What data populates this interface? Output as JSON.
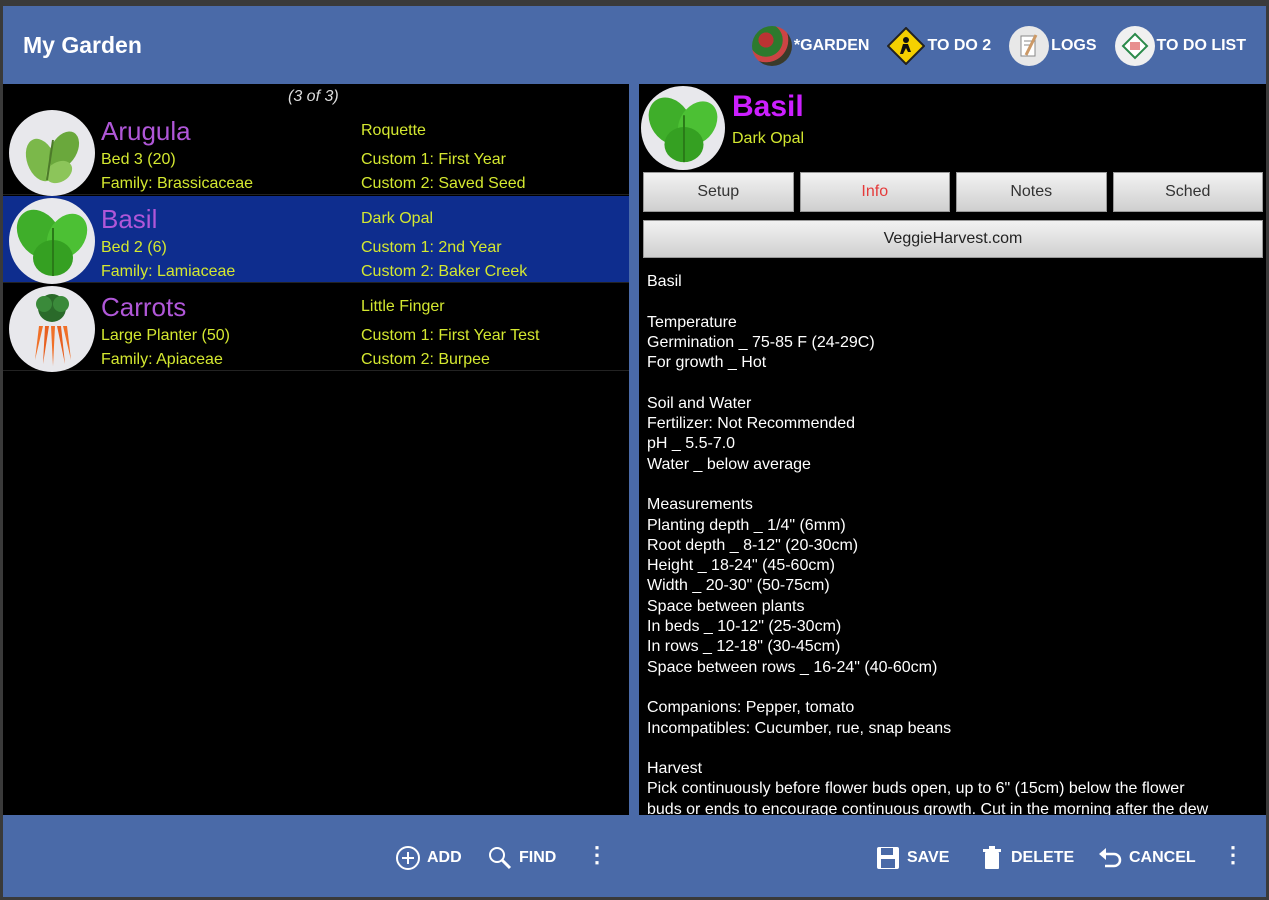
{
  "app": {
    "title": "My Garden"
  },
  "top_actions": [
    {
      "label": "*GARDEN",
      "icon": "garden-icon"
    },
    {
      "label": "TO DO 2",
      "icon": "todo-sign-icon"
    },
    {
      "label": "LOGS",
      "icon": "logs-icon"
    },
    {
      "label": "TO DO LIST",
      "icon": "todo-list-icon"
    }
  ],
  "list": {
    "count": "(3 of 3)",
    "items": [
      {
        "name": "Arugula",
        "variety": "Roquette",
        "bed": "Bed 3  (20)",
        "family": "Family: Brassicaceae",
        "custom1": "Custom 1: First Year",
        "custom2": "Custom 2: Saved Seed",
        "selected": false,
        "image": "arugula-image"
      },
      {
        "name": "Basil",
        "variety": "Dark Opal",
        "bed": "Bed 2  (6)",
        "family": "Family: Lamiaceae",
        "custom1": "Custom 1: 2nd Year",
        "custom2": "Custom 2: Baker Creek",
        "selected": true,
        "image": "basil-image"
      },
      {
        "name": "Carrots",
        "variety": "Little Finger",
        "bed": "Large Planter  (50)",
        "family": "Family: Apiaceae",
        "custom1": "Custom 1: First Year Test",
        "custom2": "Custom 2: Burpee",
        "selected": false,
        "image": "carrots-image"
      }
    ]
  },
  "detail": {
    "name": "Basil",
    "variety": "Dark Opal",
    "tabs": [
      {
        "label": "Setup",
        "active": false
      },
      {
        "label": "Info",
        "active": true
      },
      {
        "label": "Notes",
        "active": false
      },
      {
        "label": "Sched",
        "active": false
      }
    ],
    "link_label": "VeggieHarvest.com",
    "info": "Basil\n\nTemperature\nGermination _ 75-85 F (24-29C)\nFor growth _ Hot\n\nSoil and Water\nFertilizer: Not Recommended\npH _ 5.5-7.0\nWater _ below average\n\nMeasurements\nPlanting depth _ 1/4\" (6mm)\nRoot depth _ 8-12\" (20-30cm)\nHeight _ 18-24\" (45-60cm)\nWidth _ 20-30\" (50-75cm)\nSpace between plants\nIn beds _ 10-12\" (25-30cm)\nIn rows _ 12-18\" (30-45cm)\nSpace between rows _ 16-24\" (40-60cm)\n\nCompanions: Pepper, tomato\nIncompatibles: Cucumber, rue, snap beans\n\nHarvest\nPick continuously before flower buds open, up to 6\" (15cm) below the flower\nbuds or ends to encourage continuous growth. Cut in the morning after the dew"
  },
  "bottom_bar": {
    "add": "ADD",
    "find": "FIND",
    "save": "SAVE",
    "delete": "DELETE",
    "cancel": "CANCEL"
  },
  "colors": {
    "bar": "#4a6aa8",
    "selected_row": "#0e2d8e",
    "plant_name": "#b057d8",
    "detail_name": "#cc1fff",
    "yellow_text": "#d4e830",
    "active_tab": "#e53a3a"
  }
}
